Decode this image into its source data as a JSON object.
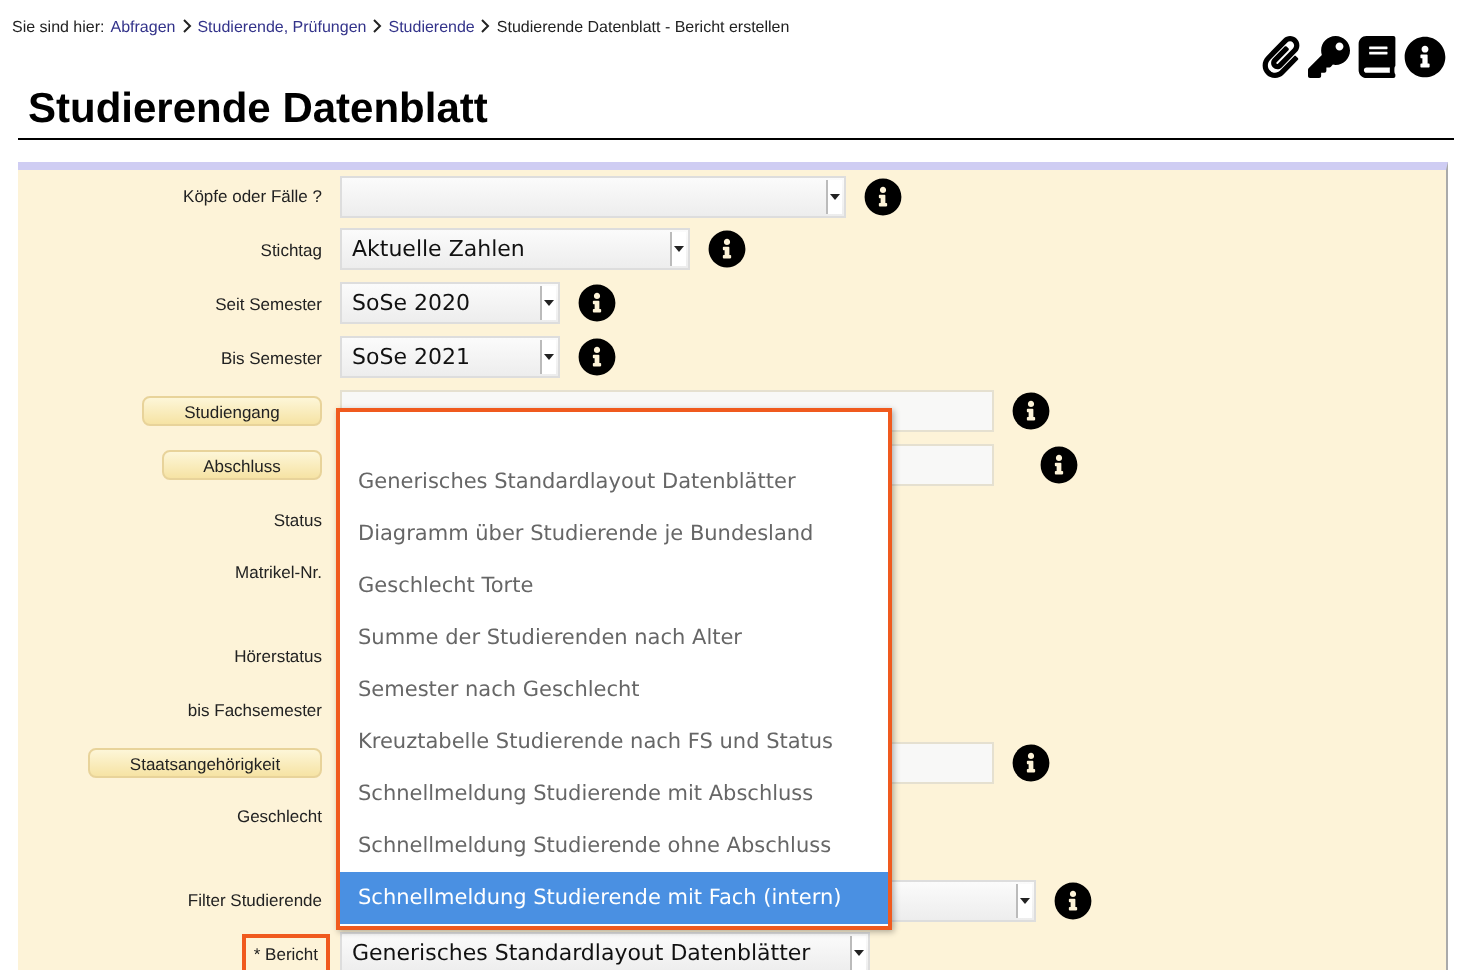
{
  "breadcrumb": {
    "prefix": "Sie sind hier:",
    "links": [
      "Abfragen",
      "Studierende, Prüfungen",
      "Studierende"
    ],
    "current": "Studierende Datenblatt - Bericht erstellen"
  },
  "title": "Studierende Datenblatt",
  "form": {
    "rows": [
      {
        "label": "Köpfe oder Fälle ?",
        "kind": "text",
        "highlighted": false,
        "field": {
          "kind": "select"
        },
        "info": true
      },
      {
        "label": "Stichtag",
        "kind": "text",
        "highlighted": false,
        "field": {
          "kind": "select",
          "value": "Aktuelle Zahlen"
        },
        "info": true
      },
      {
        "label": "Seit Semester",
        "kind": "text",
        "highlighted": false,
        "field": {
          "kind": "select",
          "value": "SoSe 2020"
        },
        "info": true
      },
      {
        "label": "Bis Semester",
        "kind": "text",
        "highlighted": false,
        "field": {
          "kind": "select",
          "value": "SoSe 2021"
        },
        "info": true
      },
      {
        "label": "Studiengang",
        "kind": "button",
        "highlighted": false,
        "field": {
          "kind": "input"
        },
        "info": true
      },
      {
        "label": "Abschluss",
        "kind": "button",
        "highlighted": false,
        "field": {
          "kind": "input"
        },
        "info": true
      },
      {
        "label": "Status",
        "kind": "text",
        "highlighted": false,
        "field": {
          "kind": "covered"
        },
        "info": false
      },
      {
        "label": "Matrikel-Nr.",
        "kind": "text",
        "highlighted": false,
        "field": {
          "kind": "covered-tall"
        },
        "info": false
      },
      {
        "label": "Hörerstatus",
        "kind": "text",
        "highlighted": false,
        "field": {
          "kind": "covered"
        },
        "info": false
      },
      {
        "label": "bis Fachsemester",
        "kind": "text",
        "highlighted": false,
        "field": {
          "kind": "covered"
        },
        "info": false
      },
      {
        "label": "Staatsangehörigkeit",
        "kind": "button",
        "highlighted": false,
        "field": {
          "kind": "input"
        },
        "info": true
      },
      {
        "label": "Geschlecht",
        "kind": "text",
        "highlighted": false,
        "field": {
          "kind": "covered-tall"
        },
        "info": false
      },
      {
        "label": "Filter Studierende",
        "kind": "text",
        "highlighted": false,
        "field": {
          "kind": "select"
        },
        "info": true
      },
      {
        "label": "* Bericht",
        "kind": "text",
        "highlighted": true,
        "field": {
          "kind": "select",
          "value": "Generisches Standardlayout Datenblätter"
        },
        "info": false
      }
    ]
  },
  "dropdown": {
    "highlighted": true,
    "options": [
      {
        "label": "Generisches Standardlayout Datenblätter",
        "selected": false
      },
      {
        "label": "Diagramm über Studierende je Bundesland",
        "selected": false
      },
      {
        "label": "Geschlecht Torte",
        "selected": false
      },
      {
        "label": "Summe der Studierenden nach Alter",
        "selected": false
      },
      {
        "label": "Semester nach Geschlecht",
        "selected": false
      },
      {
        "label": "Kreuztabelle Studierende nach FS und Status",
        "selected": false
      },
      {
        "label": "Schnellmeldung Studierende mit Abschluss",
        "selected": false
      },
      {
        "label": "Schnellmeldung Studierende ohne Abschluss",
        "selected": false
      },
      {
        "label": "Schnellmeldung Studierende mit Fach (intern)",
        "selected": true
      }
    ]
  }
}
